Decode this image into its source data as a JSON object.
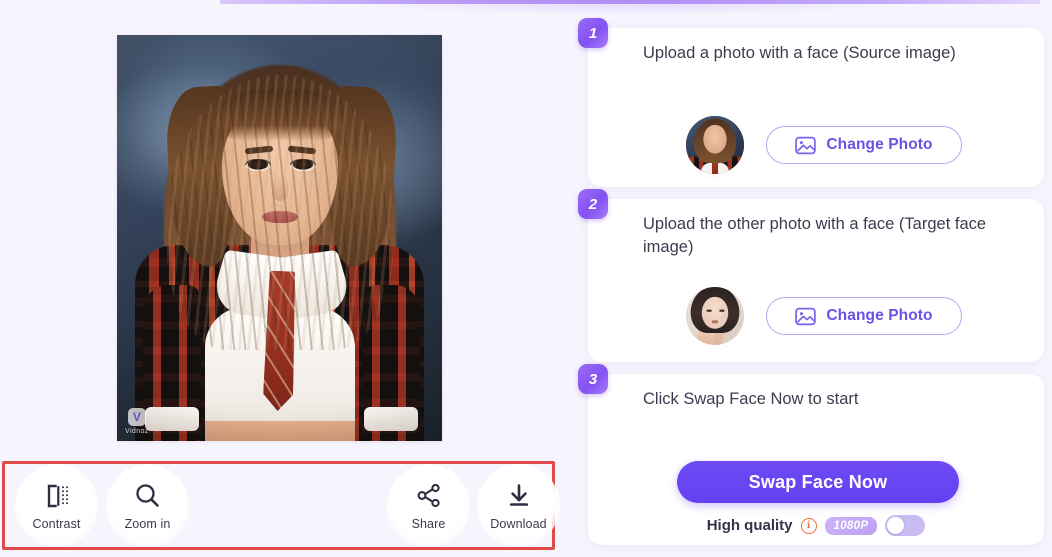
{
  "app": {
    "brand_watermark": "Vidnoz",
    "accent_purple": "#6440f2",
    "badge_purple": "#8352f2",
    "annotation_red": "#e14a4a",
    "info_orange": "#ef6b3f",
    "background": "#f6f4fd"
  },
  "preview": {
    "alt": "Swapped face result preview: young woman in red plaid shirt, white crop top and red striped necktie on dark blue studio backdrop",
    "watermark_text": "Vidnoz"
  },
  "toolbar": {
    "buttons": [
      {
        "label": "Contrast",
        "icon": "contrast-icon"
      },
      {
        "label": "Zoom in",
        "icon": "magnifier-icon"
      },
      {
        "label": "Share",
        "icon": "share-icon"
      },
      {
        "label": "Download",
        "icon": "download-icon"
      }
    ]
  },
  "steps": [
    {
      "number": "1",
      "title": "Upload a photo with a face (Source image)",
      "button_label": "Change Photo",
      "button_icon": "image-icon",
      "thumb_alt": "Source image thumbnail: woman in plaid shirt and necktie"
    },
    {
      "number": "2",
      "title": "Upload the other photo with a face (Target face image)",
      "button_label": "Change Photo",
      "button_icon": "image-icon",
      "thumb_alt": "Target face thumbnail: woman with dark hair resting chin on hand"
    },
    {
      "number": "3",
      "title": "Click Swap Face Now to start",
      "primary_button_label": "Swap Face Now",
      "quality_label": "High quality",
      "quality_info_icon": "info-icon",
      "resolution_badge": "1080P",
      "toggle_state": "off"
    }
  ]
}
